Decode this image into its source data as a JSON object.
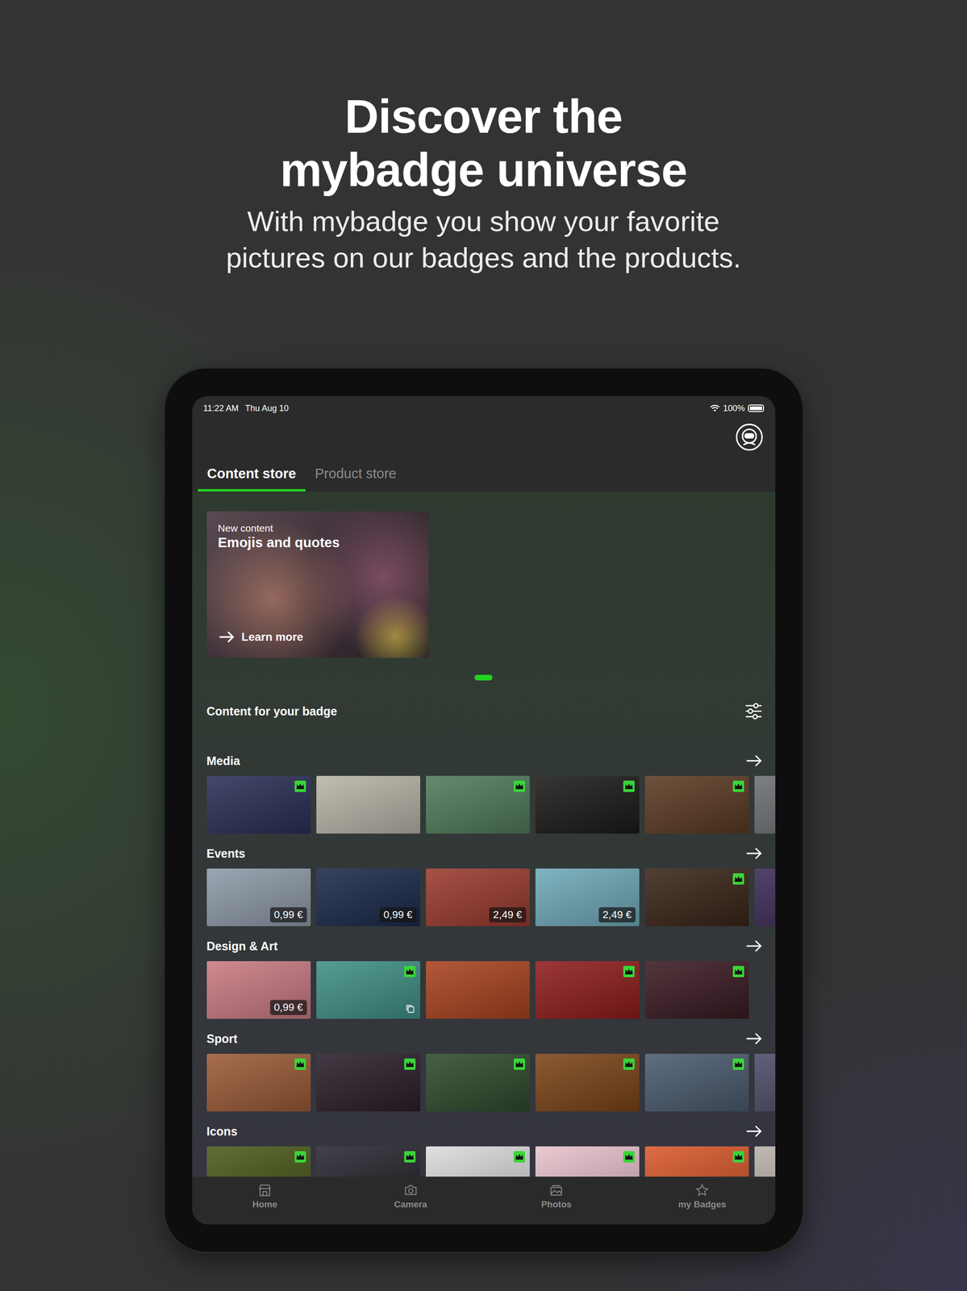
{
  "headline": {
    "title_lines": [
      "Discover the",
      "mybadge universe"
    ],
    "subtitle_lines": [
      "With mybadge you show your favorite",
      "pictures on our badges and the products."
    ]
  },
  "status_bar": {
    "time": "11:22 AM",
    "date": "Thu Aug 10",
    "battery": "100%",
    "battery_level": 1
  },
  "tabs": [
    {
      "label": "Content store",
      "selected": true
    },
    {
      "label": "Product store",
      "selected": false
    }
  ],
  "banner": {
    "eyebrow": "New content",
    "title": "Emojis and quotes",
    "link": "Learn more"
  },
  "pager": [
    {
      "selected": true
    }
  ],
  "section": {
    "title": "Content for your badge"
  },
  "categories": [
    {
      "title": "Media",
      "tiles": [
        {
          "kind": "premium",
          "color": "#2a2f55"
        },
        {
          "kind": "free",
          "color": "#b9b4a8"
        },
        {
          "kind": "premium",
          "color": "#4f7a5a"
        },
        {
          "kind": "premium",
          "color": "#1c1a18"
        },
        {
          "kind": "premium",
          "color": "#5a3a22"
        },
        {
          "kind": "free",
          "color": "#6a6e72"
        }
      ]
    },
    {
      "title": "Events",
      "tiles": [
        {
          "kind": "priced",
          "price": "0,99 €",
          "color": "#8e9aa8"
        },
        {
          "kind": "priced",
          "price": "0,99 €",
          "color": "#1b2a4a"
        },
        {
          "kind": "priced",
          "price": "2,49 €",
          "color": "#9a3a2e"
        },
        {
          "kind": "priced",
          "price": "2,49 €",
          "color": "#6fa9b8"
        },
        {
          "kind": "premium",
          "color": "#3a2418"
        },
        {
          "kind": "free",
          "color": "#3a2a55"
        }
      ]
    },
    {
      "title": "Design & Art",
      "tiles": [
        {
          "kind": "priced",
          "price": "0,99 €",
          "color": "#c97a82"
        },
        {
          "kind": "premium-set",
          "color": "#3f8f86"
        },
        {
          "kind": "free",
          "color": "#a8421e"
        },
        {
          "kind": "premium",
          "color": "#8e1c1c"
        },
        {
          "kind": "premium",
          "color": "#3a1a22"
        }
      ]
    },
    {
      "title": "Sport",
      "tiles": [
        {
          "kind": "premium",
          "color": "#9a5a36"
        },
        {
          "kind": "premium",
          "color": "#2a1e2a"
        },
        {
          "kind": "premium",
          "color": "#2d4a2d"
        },
        {
          "kind": "premium",
          "color": "#7a4418"
        },
        {
          "kind": "premium",
          "color": "#4a5a6e"
        },
        {
          "kind": "free",
          "color": "#4a4a66"
        }
      ]
    },
    {
      "title": "Icons",
      "tiles": [
        {
          "kind": "premium",
          "color": "#4a5a1a"
        },
        {
          "kind": "premium",
          "color": "#2a2630"
        },
        {
          "kind": "premium",
          "color": "#dcdcdc"
        },
        {
          "kind": "premium",
          "color": "#e8c2cc"
        },
        {
          "kind": "premium",
          "color": "#d8582a"
        },
        {
          "kind": "free",
          "color": "#b8b0a8"
        }
      ]
    }
  ],
  "nav": [
    {
      "label": "Home",
      "icon": "home",
      "selected": false
    },
    {
      "label": "Camera",
      "icon": "camera",
      "selected": false
    },
    {
      "label": "Photos",
      "icon": "photos",
      "selected": false
    },
    {
      "label": "my Badges",
      "icon": "star",
      "selected": false
    }
  ]
}
